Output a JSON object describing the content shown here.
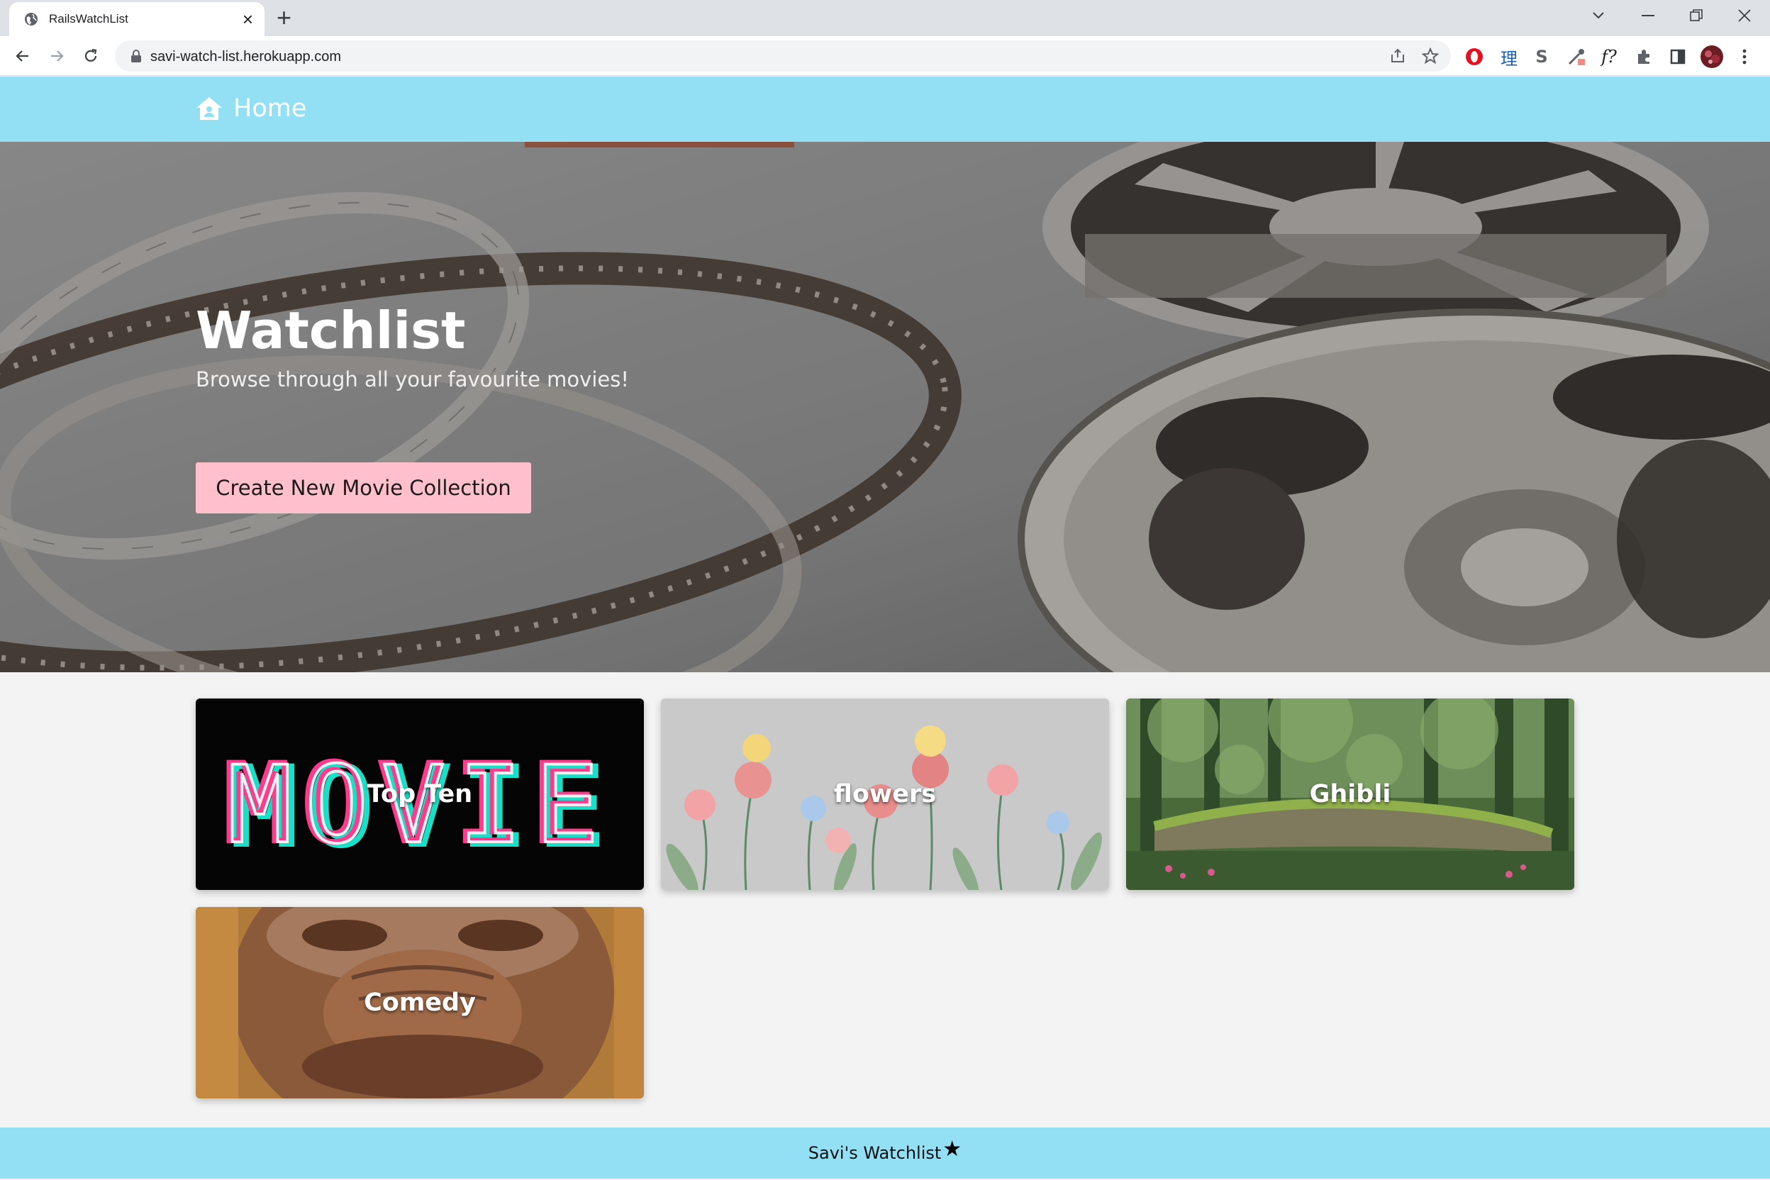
{
  "browser": {
    "tab_title": "RailsWatchList",
    "new_tab_symbol": "+",
    "url": "savi-watch-list.herokuapp.com",
    "extensions": [
      "opera-icon",
      "kanji-icon",
      "s-icon",
      "eyedropper-icon",
      "formula-icon",
      "puzzle-icon",
      "sidepanel-icon",
      "avatar"
    ]
  },
  "navbar": {
    "home_label": "Home",
    "background": "#93e0f5"
  },
  "hero": {
    "title": "Watchlist",
    "subtitle": "Browse through all your favourite movies!",
    "cta_label": "Create New Movie Collection",
    "cta_color": "#ffc0cb"
  },
  "collections": [
    {
      "label": "Top Ten",
      "image": "movie-neon-sign"
    },
    {
      "label": "flowers",
      "image": "watercolor-flowers"
    },
    {
      "label": "Ghibli",
      "image": "forest-painting"
    },
    {
      "label": "Comedy",
      "image": "ape-face"
    }
  ],
  "movie_sign_text": "MOVIE",
  "footer": {
    "text": "Savi's Watchlist",
    "icon": "star-icon",
    "star_glyph": "★"
  }
}
